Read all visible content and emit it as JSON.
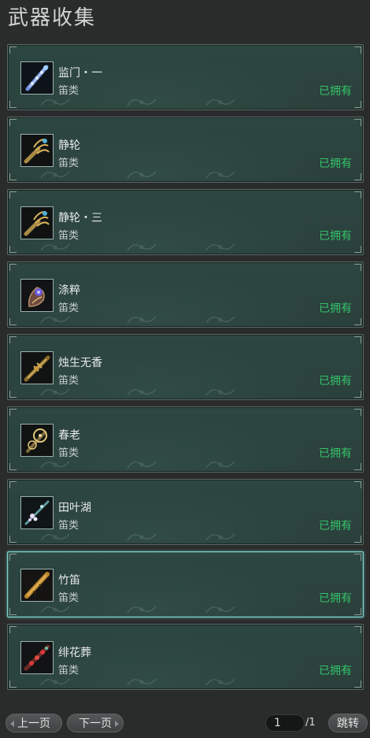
{
  "header": {
    "title": "武器收集"
  },
  "weapons": [
    {
      "name": "监门・一",
      "type": "笛类",
      "status": "已拥有",
      "icon": "blue-flute-icon",
      "selected": false
    },
    {
      "name": "静轮",
      "type": "笛类",
      "status": "已拥有",
      "icon": "gold-claw-flute-icon",
      "selected": false
    },
    {
      "name": "静轮・三",
      "type": "笛类",
      "status": "已拥有",
      "icon": "gold-claw-flute-icon",
      "selected": false
    },
    {
      "name": "涤粹",
      "type": "笛类",
      "status": "已拥有",
      "icon": "purple-orb-flute-icon",
      "selected": false
    },
    {
      "name": "烛生无香",
      "type": "笛类",
      "status": "已拥有",
      "icon": "gold-dagger-flute-icon",
      "selected": false
    },
    {
      "name": "春老",
      "type": "笛类",
      "status": "已拥有",
      "icon": "gold-swirl-flute-icon",
      "selected": false
    },
    {
      "name": "田叶湖",
      "type": "笛类",
      "status": "已拥有",
      "icon": "blossom-flute-icon",
      "selected": false
    },
    {
      "name": "竹笛",
      "type": "笛类",
      "status": "已拥有",
      "icon": "bamboo-flute-icon",
      "selected": true
    },
    {
      "name": "绯花葬",
      "type": "笛类",
      "status": "已拥有",
      "icon": "red-flower-flute-icon",
      "selected": false
    }
  ],
  "pagination": {
    "prev_label": "上一页",
    "next_label": "下一页",
    "current_page": "1",
    "total_label": "/1",
    "jump_label": "跳转"
  },
  "colors": {
    "owned_status": "#34c36a",
    "selected_border": "#7fd6cf",
    "card_bg": "#2d4641"
  }
}
